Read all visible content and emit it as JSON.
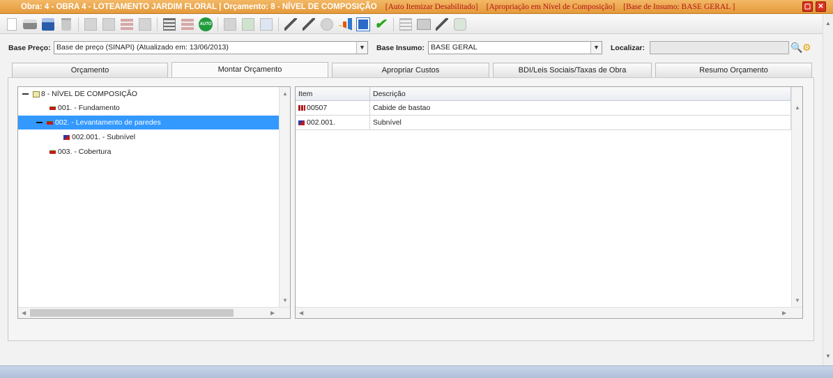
{
  "window": {
    "title": "Obra: 4 - OBRA 4 - LOTEAMENTO JARDIM FLORAL | Orçamento: 8 - NÍVEL DE COMPOSIÇÃO",
    "flags": [
      "[Auto Itemizar Desabilitado]",
      "[Apropriação em Nível de Composição]",
      "[Base de Insumo: BASE GERAL ]"
    ],
    "accent_color": "#e9a74e",
    "flag_color": "#b3141a"
  },
  "toolbar": {
    "icons": [
      "new-document-icon",
      "print-icon",
      "save-icon",
      "delete-icon",
      "copy-icon",
      "paste-icon",
      "insert-item-icon",
      "calculator-icon",
      "list-icon",
      "sort-icon",
      "auto-icon",
      "grid-icon",
      "money-icon",
      "tag-icon",
      "wizard-icon",
      "edit-icon",
      "link-icon",
      "chart-icon",
      "clone-icon",
      "confirm-icon",
      "report-icon",
      "book-icon",
      "pen-icon",
      "add-icon"
    ],
    "auto_label": "AUTO"
  },
  "filters": {
    "base_preco_label": "Base Preço:",
    "base_preco_value": "Base de preço (SINAPI) (Atualizado em: 13/06/2013)",
    "base_insumo_label": "Base Insumo:",
    "base_insumo_value": "BASE GERAL",
    "localizar_label": "Localizar:",
    "localizar_value": ""
  },
  "tabs": [
    {
      "label": "Orçamento",
      "active": false
    },
    {
      "label": "Montar Orçamento",
      "active": true
    },
    {
      "label": "Apropriar Custos",
      "active": false
    },
    {
      "label": "BDI/Leis Sociais/Taxas de Obra",
      "active": false
    },
    {
      "label": "Resumo Orçamento",
      "active": false
    }
  ],
  "tree": {
    "root": "8 - NÍVEL DE COMPOSIÇÃO",
    "nodes": [
      {
        "label": "001. - Fundamento",
        "selected": false
      },
      {
        "label": "002. - Levantamento de paredes",
        "selected": true
      },
      {
        "label": "002.001. - Subnível",
        "selected": false
      },
      {
        "label": "003. - Cobertura",
        "selected": false
      }
    ],
    "selection_color": "#3399ff"
  },
  "grid": {
    "columns": [
      "Item",
      "Descrição"
    ],
    "rows": [
      {
        "item": "00507",
        "descricao": "Cabide de bastao",
        "icon": "composition-icon"
      },
      {
        "item": "002.001.",
        "descricao": "Subnível",
        "icon": "sublevel-icon"
      }
    ]
  }
}
